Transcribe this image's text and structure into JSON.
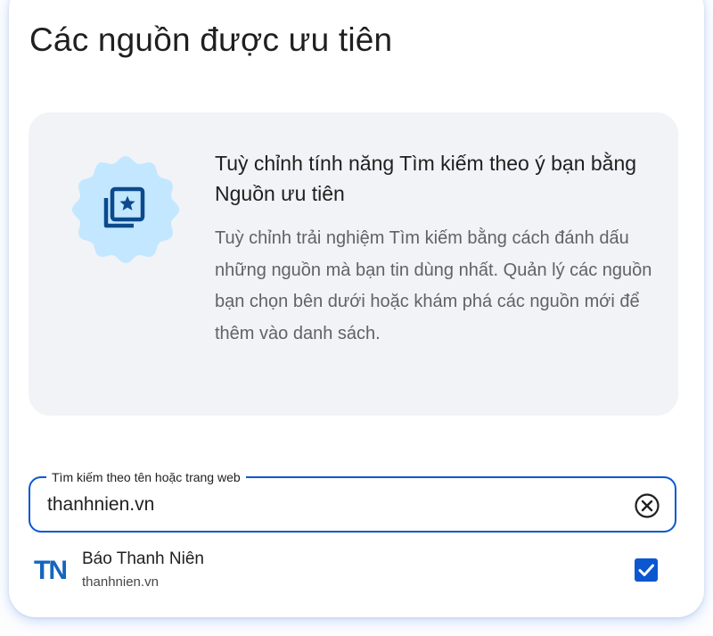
{
  "page": {
    "title": "Các nguồn được ưu tiên"
  },
  "info": {
    "icon": "preferred-sources-star-icon",
    "heading": "Tuỳ chỉnh tính năng Tìm kiếm theo ý bạn bằng Nguồn ưu tiên",
    "body": "Tuỳ chỉnh trải nghiệm Tìm kiếm bằng cách đánh dấu những nguồn mà bạn tin dùng nhất. Quản lý các nguồn bạn chọn bên dưới hoặc khám phá các nguồn mới để thêm vào danh sách."
  },
  "search": {
    "label": "Tìm kiếm theo tên hoặc trang web",
    "value": "thanhnien.vn",
    "clear_icon": "clear-circle-x-icon"
  },
  "results": [
    {
      "logo_text": "TN",
      "name": "Báo Thanh Niên",
      "url": "thanhnien.vn",
      "checked": true
    }
  ],
  "colors": {
    "accent": "#0b57d0",
    "badge_fill": "#c2e7ff",
    "badge_icon": "#0b4a8b",
    "logo": "#1565c0",
    "panel_bg": "#f1f3f6"
  }
}
